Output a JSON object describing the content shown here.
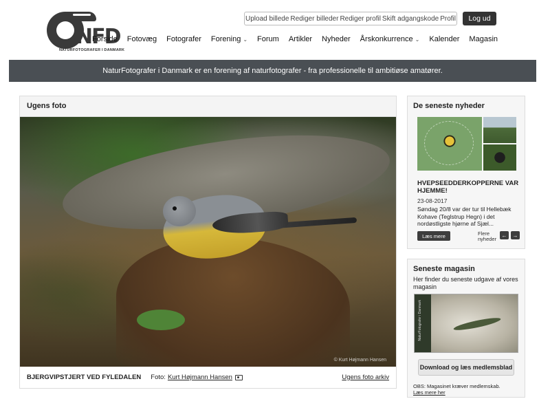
{
  "brand": {
    "logo_text": "NFD",
    "logo_subtitle": "NATURFOTOGRAFER I DANMARK"
  },
  "user_bar": [
    "Upload billede",
    "Rediger billeder",
    "Rediger profil",
    "Skift adgangskode",
    "Profil"
  ],
  "logout_label": "Log ud",
  "main_nav": [
    {
      "label": "Forside",
      "dropdown": false
    },
    {
      "label": "Fotovæg",
      "dropdown": false
    },
    {
      "label": "Fotografer",
      "dropdown": false
    },
    {
      "label": "Forening",
      "dropdown": true
    },
    {
      "label": "Forum",
      "dropdown": false
    },
    {
      "label": "Artikler",
      "dropdown": false
    },
    {
      "label": "Nyheder",
      "dropdown": false
    },
    {
      "label": "Årskonkurrence",
      "dropdown": true
    },
    {
      "label": "Kalender",
      "dropdown": false
    },
    {
      "label": "Magasin",
      "dropdown": false
    }
  ],
  "banner_text": "NaturFotografer i Danmark er en forening af naturfotografer - fra professionelle til ambitiøse amatører.",
  "weekly_photo": {
    "header": "Ugens foto",
    "caption": "BJERGVIPSTJERT VED FYLEDALEN",
    "photo_label": "Foto:",
    "photographer": "Kurt Højmann Hansen",
    "watermark": "© Kurt Højmann Hansen",
    "archive_link": "Ugens foto arkiv"
  },
  "news": {
    "header": "De seneste nyheder",
    "title": "HVEPSEEDDERKOPPERNE VAR HJEMME!",
    "date": "23-08-2017",
    "excerpt": "Søndag 20/8 var der tur til Hellebæk Kohave (Teglstrup Hegn) i det nordøstligste hjørne af Sjæl...",
    "read_more": "Læs mere",
    "more_news": "Flere nyheder"
  },
  "magazine": {
    "header": "Seneste magasin",
    "description": "Her finder du seneste udgave af vores magasin",
    "cover_spine": "NaturFotografer i Danmark",
    "download_label": "Download og læs medlemsblad",
    "note": "OBS: Magasinet kræver medlemskab.",
    "note_link": "Læs mere her"
  }
}
